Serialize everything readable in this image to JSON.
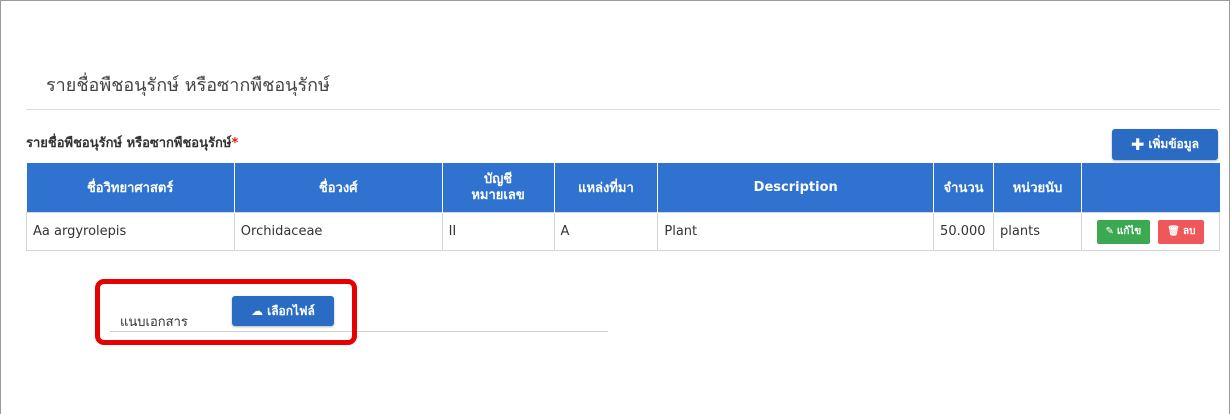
{
  "section": {
    "title": "รายชื่อพืชอนุรักษ์ หรือซากพืชอนุรักษ์"
  },
  "field": {
    "label": "รายชื่อพืชอนุรักษ์ หรือซากพืชอนุรักษ์",
    "required_mark": "*"
  },
  "add_button": {
    "label": "เพิ่มข้อมูล",
    "icon": "plus-icon"
  },
  "table": {
    "headers": [
      "ชื่อวิทยาศาสตร์",
      "ชื่อวงศ์",
      "บัญชี หมายเลข",
      "แหล่งที่มา",
      "Description",
      "จำนวน",
      "หน่วยนับ",
      ""
    ],
    "rows": [
      {
        "scientific_name": "Aa argyrolepis",
        "family": "Orchidaceae",
        "appendix": "II",
        "source": "A",
        "description": "Plant",
        "quantity": "50.000",
        "unit": "plants",
        "edit_label": "แก้ไข",
        "delete_label": "ลบ"
      }
    ]
  },
  "attachment": {
    "label": "แนบเอกสาร",
    "button_label": "เลือกไฟล์",
    "button_icon": "cloud-upload-icon"
  },
  "colors": {
    "header_bg": "#2f72cf",
    "button_bg": "#2a6cc4",
    "edit_bg": "#3ca852",
    "delete_bg": "#f0575a",
    "highlight": "#e60000",
    "required": "#d9241d"
  }
}
